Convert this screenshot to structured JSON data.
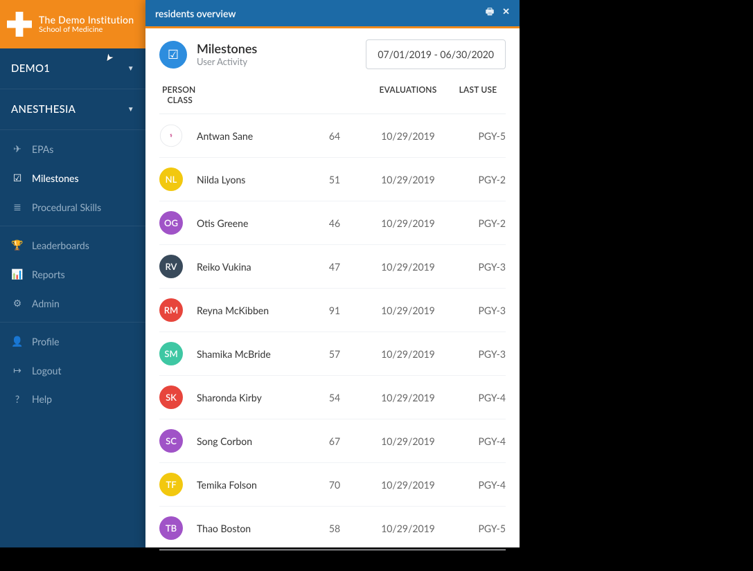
{
  "brand": {
    "title": "The Demo Institution",
    "subtitle": "School of Medicine"
  },
  "sidebar": {
    "dd1": "DEMO1",
    "dd2": "ANESTHESIA",
    "groups": {
      "nav": [
        {
          "label": "EPAs",
          "icon": "✈"
        },
        {
          "label": "Milestones",
          "icon": "☑"
        },
        {
          "label": "Procedural Skills",
          "icon": "≣"
        }
      ],
      "stats": [
        {
          "label": "Leaderboards",
          "icon": "🏆"
        },
        {
          "label": "Reports",
          "icon": "📊"
        },
        {
          "label": "Admin",
          "icon": "⚙"
        }
      ],
      "account": [
        {
          "label": "Profile",
          "icon": "👤"
        },
        {
          "label": "Logout",
          "icon": "↦"
        },
        {
          "label": "Help",
          "icon": "?"
        }
      ]
    },
    "active": "Milestones"
  },
  "panel": {
    "title": "residents overview",
    "milestones": {
      "title": "Milestones",
      "subtitle": "User Activity"
    },
    "daterange": "07/01/2019 - 06/30/2020"
  },
  "table": {
    "headers": {
      "person": "PERSON",
      "eval": "EVALUATIONS",
      "last": "LAST USE",
      "class": "CLASS"
    },
    "rows": [
      {
        "initials": "",
        "avatarColor": "img",
        "name": "Antwan Sane",
        "eval": "64",
        "last": "10/29/2019",
        "class": "PGY-5"
      },
      {
        "initials": "NL",
        "avatarColor": "#f2c80f",
        "name": "Nilda Lyons",
        "eval": "51",
        "last": "10/29/2019",
        "class": "PGY-2"
      },
      {
        "initials": "OG",
        "avatarColor": "#a053c7",
        "name": "Otis Greene",
        "eval": "46",
        "last": "10/29/2019",
        "class": "PGY-2"
      },
      {
        "initials": "RV",
        "avatarColor": "#394a5b",
        "name": "Reiko Vukina",
        "eval": "47",
        "last": "10/29/2019",
        "class": "PGY-3"
      },
      {
        "initials": "RM",
        "avatarColor": "#e7453c",
        "name": "Reyna McKibben",
        "eval": "91",
        "last": "10/29/2019",
        "class": "PGY-3"
      },
      {
        "initials": "SM",
        "avatarColor": "#3ec7a3",
        "name": "Shamika McBride",
        "eval": "57",
        "last": "10/29/2019",
        "class": "PGY-3"
      },
      {
        "initials": "SK",
        "avatarColor": "#e7453c",
        "name": "Sharonda Kirby",
        "eval": "54",
        "last": "10/29/2019",
        "class": "PGY-4"
      },
      {
        "initials": "SC",
        "avatarColor": "#a053c7",
        "name": "Song Corbon",
        "eval": "67",
        "last": "10/29/2019",
        "class": "PGY-4"
      },
      {
        "initials": "TF",
        "avatarColor": "#f2c80f",
        "name": "Temika Folson",
        "eval": "70",
        "last": "10/29/2019",
        "class": "PGY-4"
      },
      {
        "initials": "TB",
        "avatarColor": "#a053c7",
        "name": "Thao Boston",
        "eval": "58",
        "last": "10/29/2019",
        "class": "PGY-5"
      }
    ]
  }
}
